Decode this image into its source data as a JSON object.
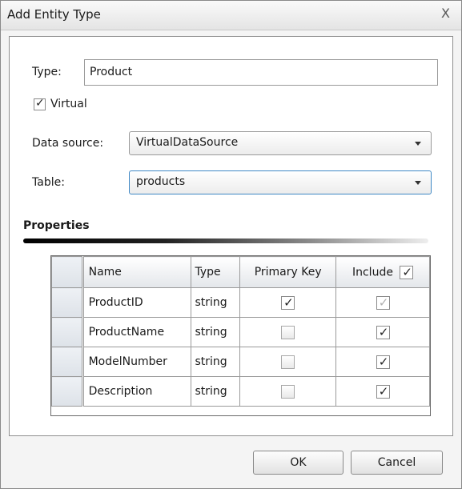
{
  "dialog": {
    "title": "Add Entity Type",
    "close_label": "X"
  },
  "form": {
    "type_label": "Type:",
    "type_value": "Product",
    "virtual_label": "Virtual",
    "virtual_checked": true,
    "datasource_label": "Data source:",
    "datasource_value": "VirtualDataSource",
    "table_label": "Table:",
    "table_value": "products"
  },
  "properties": {
    "section_title": "Properties",
    "columns": {
      "name": "Name",
      "type": "Type",
      "primary_key": "Primary Key",
      "include": "Include"
    },
    "include_all_checked": true,
    "rows": [
      {
        "name": "ProductID",
        "type": "string",
        "primary_key": true,
        "include": true,
        "include_disabled": true
      },
      {
        "name": "ProductName",
        "type": "string",
        "primary_key": false,
        "include": true,
        "include_disabled": false
      },
      {
        "name": "ModelNumber",
        "type": "string",
        "primary_key": false,
        "include": true,
        "include_disabled": false
      },
      {
        "name": "Description",
        "type": "string",
        "primary_key": false,
        "include": true,
        "include_disabled": false
      }
    ]
  },
  "buttons": {
    "ok": "OK",
    "cancel": "Cancel"
  }
}
